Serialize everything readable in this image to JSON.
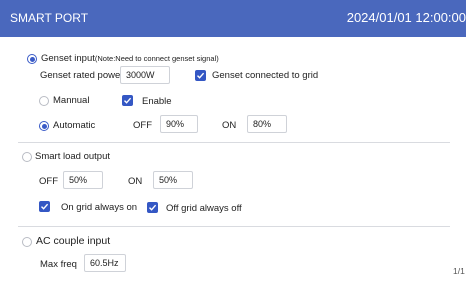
{
  "header": {
    "title": "SMART PORT",
    "datetime": "2024/01/01 12:00:00"
  },
  "genset": {
    "input_label": "Genset input",
    "note": "(Note:Need to connect genset signal)",
    "rated_power_label": "Genset rated power",
    "rated_power_value": "3000W",
    "connected_to_grid_label": "Genset connected to grid",
    "manual_label": "Mannual",
    "enable_label": "Enable",
    "automatic_label": "Automatic",
    "off_label": "OFF",
    "off_value": "90%",
    "on_label": "ON",
    "on_value": "80%"
  },
  "smart_load": {
    "label": "Smart load output",
    "off_label": "OFF",
    "off_value": "50%",
    "on_label": "ON",
    "on_value": "50%",
    "on_grid_always_on_label": "On grid always on",
    "off_grid_always_off_label": "Off grid always off"
  },
  "ac_couple": {
    "label": "AC couple input",
    "max_freq_label": "Max freq",
    "max_freq_value": "60.5Hz"
  },
  "pagination": {
    "text": "1/1"
  },
  "colors": {
    "header_bg": "#4a68bd",
    "accent": "#3457c4"
  }
}
